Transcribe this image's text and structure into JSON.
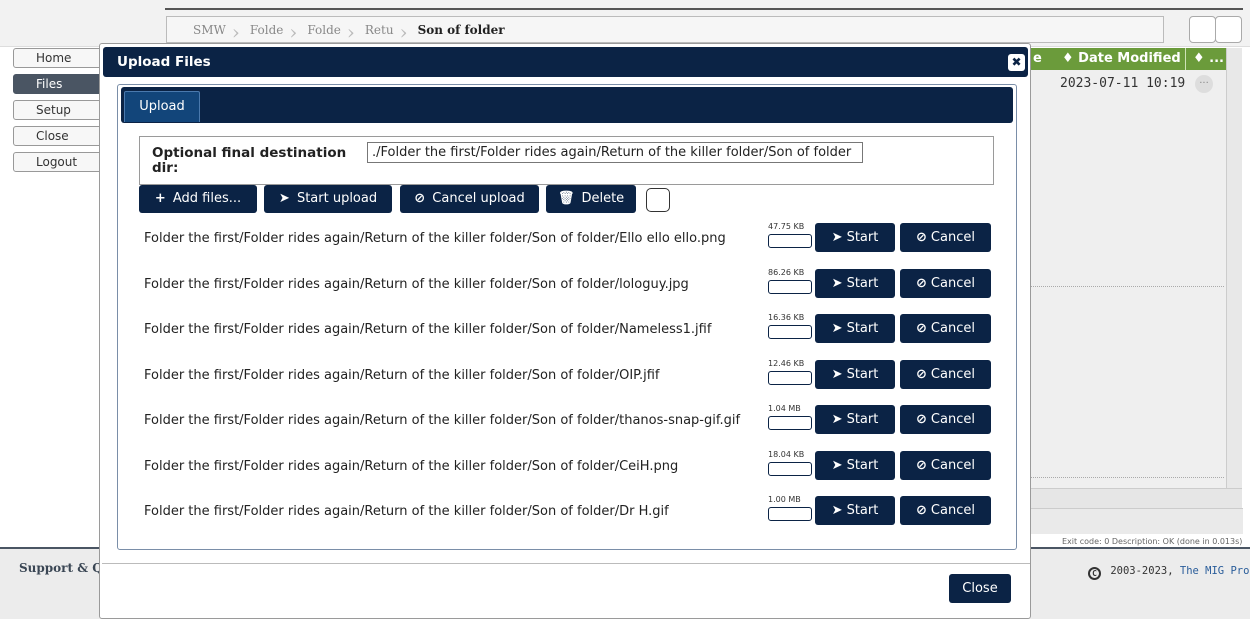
{
  "breadcrumb": [
    "SMW",
    "Folde",
    "Folde",
    "Retu",
    "Son of folder"
  ],
  "sidebar": {
    "items": [
      "Home",
      "Files",
      "Setup",
      "Close",
      "Logout"
    ],
    "active": 1
  },
  "background": {
    "col_header": "♦ Date Modified",
    "col_more": "♦ ...",
    "col_partial": "e",
    "date": "2023-07-11 10:19",
    "dots": "...",
    "status_partial": "e.",
    "exit_line": "Exit code: 0 Description: OK (done in 0.013s)"
  },
  "footer": {
    "left": "Support & Qu",
    "copyright": "2003-2023,",
    "project_link": "The MIG Project"
  },
  "dialog": {
    "title": "Upload Files",
    "close_symbol": "✖",
    "tab": "Upload",
    "dest_label": "Optional final destination dir:",
    "dest_value": "./Folder the first/Folder rides again/Return of the killer folder/Son of folder",
    "toolbar": {
      "add": "Add files...",
      "start": "Start upload",
      "cancel": "Cancel upload",
      "delete": "Delete"
    },
    "row_start": "Start",
    "row_cancel": "Cancel",
    "close_button": "Close",
    "files": [
      {
        "name": "Folder the first/Folder rides again/Return of the killer folder/Son of folder/Ello ello ello.png",
        "size": "47.75 KB"
      },
      {
        "name": "Folder the first/Folder rides again/Return of the killer folder/Son of folder/lologuy.jpg",
        "size": "86.26 KB"
      },
      {
        "name": "Folder the first/Folder rides again/Return of the killer folder/Son of folder/Nameless1.jfif",
        "size": "16.36 KB"
      },
      {
        "name": "Folder the first/Folder rides again/Return of the killer folder/Son of folder/OIP.jfif",
        "size": "12.46 KB"
      },
      {
        "name": "Folder the first/Folder rides again/Return of the killer folder/Son of folder/thanos-snap-gif.gif",
        "size": "1.04 MB"
      },
      {
        "name": "Folder the first/Folder rides again/Return of the killer folder/Son of folder/CeiH.png",
        "size": "18.04 KB"
      },
      {
        "name": "Folder the first/Folder rides again/Return of the killer folder/Son of folder/Dr H.gif",
        "size": "1.00 MB"
      }
    ]
  }
}
